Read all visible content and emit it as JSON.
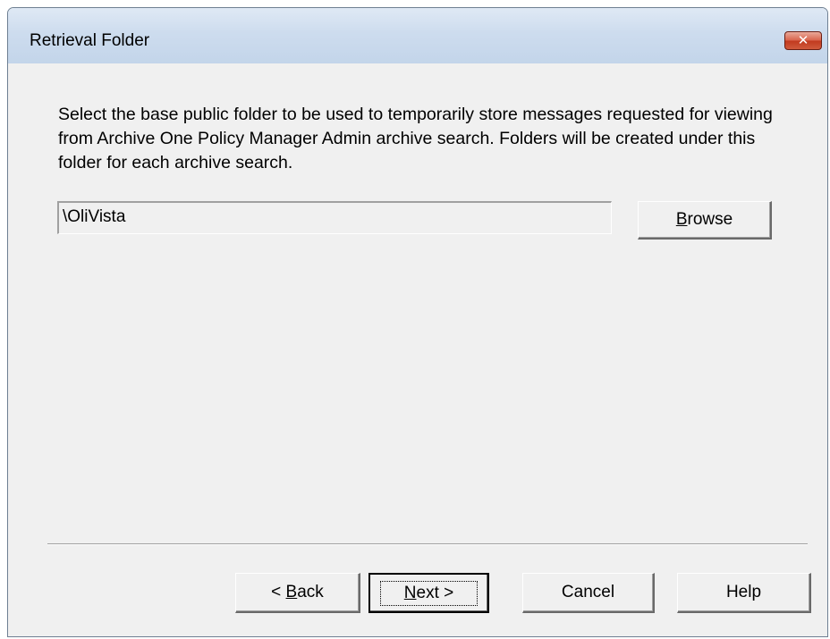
{
  "window": {
    "title": "Retrieval Folder",
    "close_glyph": "✕"
  },
  "description": "Select the base public folder to be used to temporarily store messages requested for viewing from Archive One Policy Manager Admin archive search. Folders will be created under this folder for each archive search.",
  "folder_path": {
    "value": "\\OliVista"
  },
  "buttons": {
    "browse_pre": "B",
    "browse_rest": "rowse",
    "back_pre": "< ",
    "back_accel": "B",
    "back_rest": "ack",
    "next_accel": "N",
    "next_rest": "ext >",
    "cancel": "Cancel",
    "help": "Help"
  },
  "icons": {
    "close": "close-icon"
  },
  "colors": {
    "titlebar": "#c9d9ed",
    "close_button": "#c8452a",
    "dialog_bg": "#f0f0f0"
  }
}
